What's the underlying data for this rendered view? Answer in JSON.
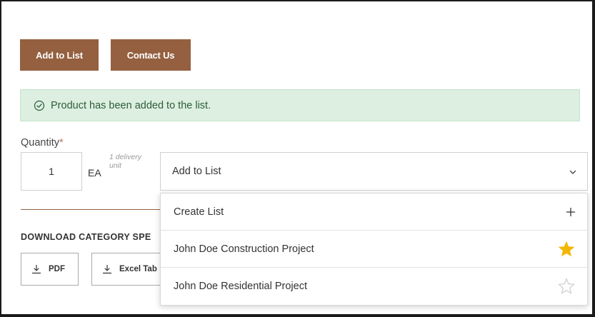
{
  "actions": {
    "add_to_list_label": "Add to List",
    "contact_label": "Contact Us"
  },
  "alert": {
    "message": "Product has been added to the list."
  },
  "quantity": {
    "label": "Quantity",
    "required_mark": "*",
    "value": "1",
    "unit": "EA",
    "delivery_note": "1 delivery unit"
  },
  "list_select": {
    "selected": "Add to List"
  },
  "dropdown": {
    "create_label": "Create List",
    "items": [
      {
        "label": "John Doe Construction Project",
        "favorite": true
      },
      {
        "label": "John Doe Residential Project",
        "favorite": false
      }
    ]
  },
  "download": {
    "heading": "DOWNLOAD CATEGORY SPE",
    "pdf_label": "PDF",
    "excel_label": "Excel Tab"
  },
  "colors": {
    "brand_brown": "#94603f",
    "success_bg": "#dcefe0",
    "success_text": "#2f5c3b",
    "star_active": "#f2b705",
    "star_inactive": "#cccccc"
  },
  "icons": {
    "alert": "check-circle-icon",
    "select": "chevron-down-icon",
    "create": "plus-icon",
    "favorite_on": "star-filled-icon",
    "favorite_off": "star-outline-icon",
    "download": "download-icon"
  }
}
